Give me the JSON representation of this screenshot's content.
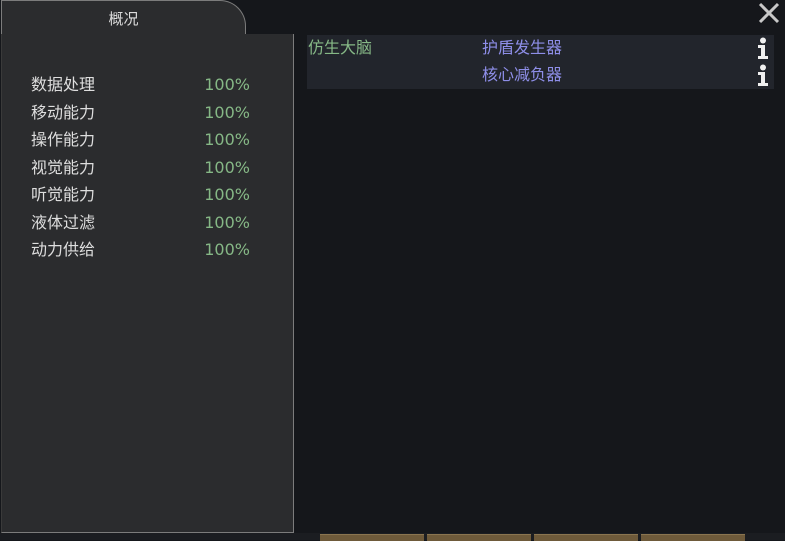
{
  "tab": {
    "label": "概况"
  },
  "capacities": [
    {
      "name": "数据处理",
      "value": "100%"
    },
    {
      "name": "移动能力",
      "value": "100%"
    },
    {
      "name": "操作能力",
      "value": "100%"
    },
    {
      "name": "视觉能力",
      "value": "100%"
    },
    {
      "name": "听觉能力",
      "value": "100%"
    },
    {
      "name": "液体过滤",
      "value": "100%"
    },
    {
      "name": "动力供给",
      "value": "100%"
    }
  ],
  "parts": [
    {
      "part": "仿生大脑",
      "hediff": "护盾发生器",
      "info_icon": "info-icon"
    },
    {
      "part": "",
      "hediff": "核心减负器",
      "info_icon": "info-icon"
    }
  ],
  "icons": {
    "close": "close-icon",
    "info": "info-icon"
  },
  "colors": {
    "capacity_value": "#86b886",
    "part_name": "#86b886",
    "hediff_name": "#8e8ee8",
    "panel_bg": "#2b2c2e",
    "window_bg": "#15171b"
  }
}
